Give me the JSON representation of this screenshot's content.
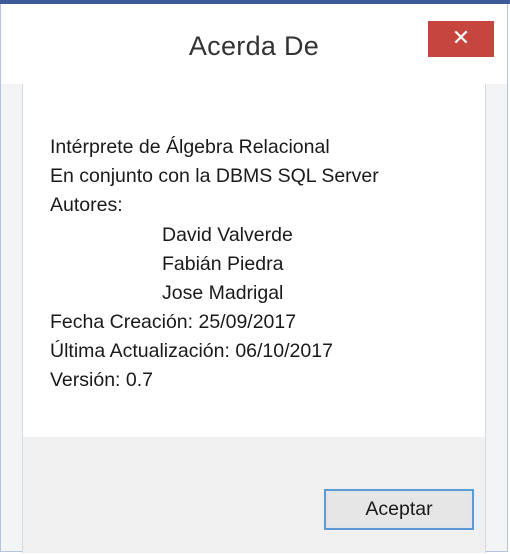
{
  "window": {
    "title": "Acerda De",
    "close_icon": "close-icon",
    "close_glyph": "✕"
  },
  "about": {
    "app_name": "Intérprete de Álgebra Relacional",
    "dbms_line": "En conjunto con la DBMS SQL Server",
    "authors_label": "Autores:",
    "authors": [
      "David Valverde",
      "Fabián Piedra",
      "Jose Madrigal"
    ],
    "creation_date": "Fecha Creación: 25/09/2017",
    "last_update": "Última Actualización: 06/10/2017",
    "version": "Versión: 0.7"
  },
  "buttons": {
    "ok_label": "Aceptar"
  },
  "colors": {
    "close_button": "#c6463f",
    "focus_border": "#5a9ad6",
    "accent_top": "#3d5a99"
  }
}
